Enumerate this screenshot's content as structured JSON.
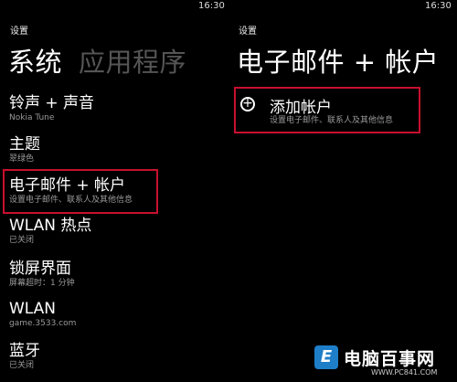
{
  "status_time_left": "16:30",
  "status_time_right": "16:30",
  "left": {
    "section_title": "设置",
    "pivot_active": "系统",
    "pivot_next": "应用程序",
    "items": [
      {
        "title": "铃声 + 声音",
        "subtitle": "Nokia Tune"
      },
      {
        "title": "主题",
        "subtitle": "翠绿色"
      },
      {
        "title": "电子邮件 + 帐户",
        "subtitle": "设置电子邮件、联系人及其他信息"
      },
      {
        "title": "WLAN 热点",
        "subtitle": "已关闭"
      },
      {
        "title": "锁屏界面",
        "subtitle": "屏幕超时：1 分钟"
      },
      {
        "title": "WLAN",
        "subtitle": "game.3533.com"
      },
      {
        "title": "蓝牙",
        "subtitle": "已关闭"
      }
    ]
  },
  "right": {
    "section_title": "设置",
    "page_title": "电子邮件 + 帐户",
    "add_account": {
      "title": "添加帐户",
      "subtitle": "设置电子邮件、联系人及其他信息",
      "icon": "plus-circle-icon"
    }
  },
  "watermark": {
    "logo_text": "E",
    "name": "电脑百事网",
    "site": "WWW.PC841.COM"
  },
  "colors": {
    "background": "#000000",
    "highlight": "#c8102e",
    "subtitle": "#9a9a9a"
  }
}
